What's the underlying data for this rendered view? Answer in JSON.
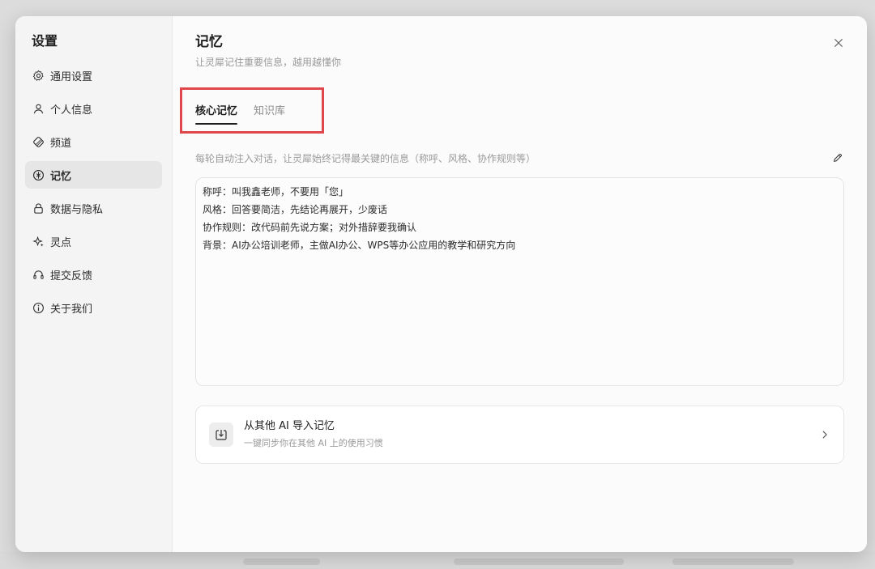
{
  "sidebar": {
    "title": "设置",
    "items": [
      {
        "label": "通用设置",
        "icon": "gear-icon"
      },
      {
        "label": "个人信息",
        "icon": "user-icon"
      },
      {
        "label": "频道",
        "icon": "channel-icon"
      },
      {
        "label": "记忆",
        "icon": "memory-icon",
        "active": true
      },
      {
        "label": "数据与隐私",
        "icon": "lock-icon"
      },
      {
        "label": "灵点",
        "icon": "sparkle-icon"
      },
      {
        "label": "提交反馈",
        "icon": "headset-icon"
      },
      {
        "label": "关于我们",
        "icon": "info-icon"
      }
    ]
  },
  "main": {
    "title": "记忆",
    "subtitle": "让灵犀记住重要信息，越用越懂你",
    "tabs": [
      {
        "label": "核心记忆",
        "active": true
      },
      {
        "label": "知识库",
        "active": false
      }
    ],
    "description": "每轮自动注入对话，让灵犀始终记得最关键的信息（称呼、风格、协作规则等）",
    "memory_lines": [
      "称呼：叫我鑫老师，不要用「您」",
      "风格：回答要简洁，先结论再展开，少废话",
      "协作规则：改代码前先说方案；对外措辞要我确认",
      "背景：AI办公培训老师，主做AI办公、WPS等办公应用的教学和研究方向"
    ],
    "import_card": {
      "title": "从其他 AI 导入记忆",
      "subtitle": "一键同步你在其他 AI 上的使用习惯",
      "icon": "import-icon"
    }
  },
  "colors": {
    "highlight_border": "#e0474c",
    "active_nav_bg": "#e6e6e6",
    "sidebar_bg": "#f4f4f4"
  }
}
